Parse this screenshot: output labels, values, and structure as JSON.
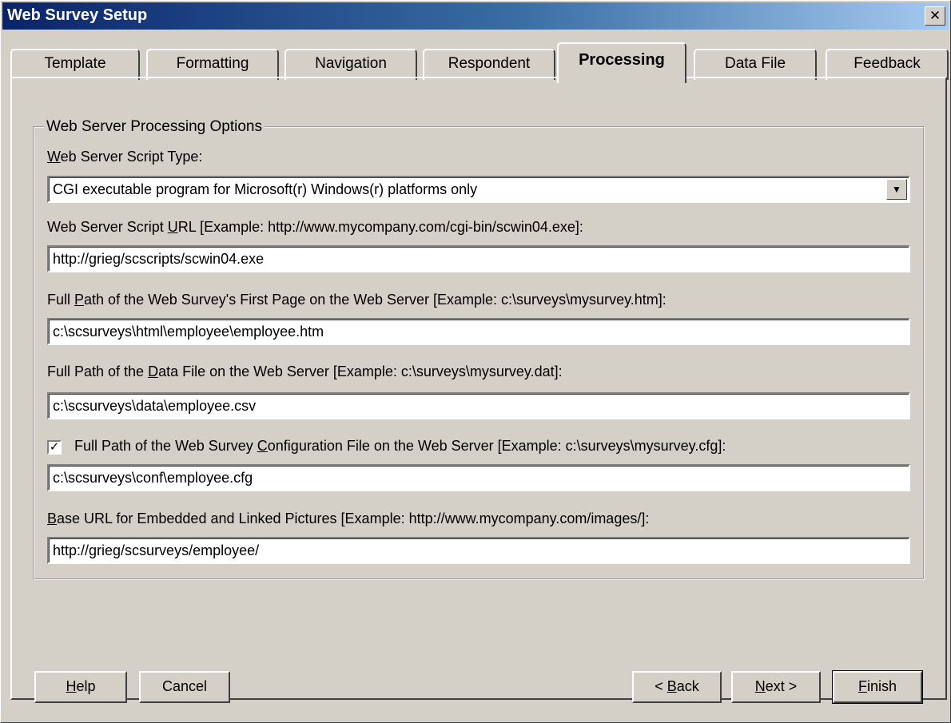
{
  "window": {
    "title": "Web Survey Setup",
    "close_label": "✕"
  },
  "tabs": [
    {
      "label": "Template"
    },
    {
      "label": "Formatting"
    },
    {
      "label": "Navigation"
    },
    {
      "label": "Respondent"
    },
    {
      "label": "Processing"
    },
    {
      "label": "Data File"
    },
    {
      "label": "Feedback"
    }
  ],
  "active_tab": "Processing",
  "group": {
    "title": "Web Server Processing Options"
  },
  "script_type": {
    "label_pre": "",
    "label_u": "W",
    "label_post": "eb Server Script Type:",
    "value": "CGI executable program for Microsoft(r) Windows(r) platforms only"
  },
  "script_url": {
    "label_pre": "Web Server Script ",
    "label_u": "U",
    "label_post": "RL [Example: http://www.mycompany.com/cgi-bin/scwin04.exe]:",
    "value": "http://grieg/scscripts/scwin04.exe"
  },
  "first_page": {
    "label_pre": "Full ",
    "label_u": "P",
    "label_post": "ath of the Web Survey's First Page on the Web Server [Example: c:\\surveys\\mysurvey.htm]:",
    "value": "c:\\scsurveys\\html\\employee\\employee.htm"
  },
  "data_file": {
    "label_pre": "Full Path of the ",
    "label_u": "D",
    "label_post": "ata File on the Web Server [Example: c:\\surveys\\mysurvey.dat]:",
    "value": "c:\\scsurveys\\data\\employee.csv"
  },
  "config_file": {
    "checked": true,
    "check_mark": "✓",
    "label_pre": "Full Path of the Web Survey ",
    "label_u": "C",
    "label_post": "onfiguration File on the Web Server [Example: c:\\surveys\\mysurvey.cfg]:",
    "value": "c:\\scsurveys\\conf\\employee.cfg"
  },
  "base_url": {
    "label_pre": "",
    "label_u": "B",
    "label_post": "ase URL for Embedded and Linked Pictures [Example: http://www.mycompany.com/images/]:",
    "value": "http://grieg/scsurveys/employee/"
  },
  "buttons": {
    "help": {
      "pre": "",
      "u": "H",
      "post": "elp"
    },
    "cancel": {
      "label": "Cancel"
    },
    "back": {
      "pre": "< ",
      "u": "B",
      "post": "ack"
    },
    "next": {
      "pre": "",
      "u": "N",
      "post": "ext >"
    },
    "finish": {
      "pre": "",
      "u": "F",
      "post": "inish"
    }
  },
  "dropdown_icon": "chevron-down-icon"
}
